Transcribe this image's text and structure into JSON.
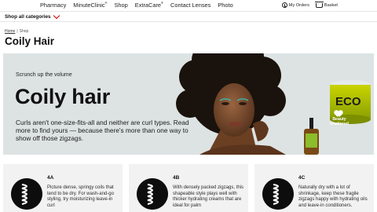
{
  "nav": {
    "links": [
      {
        "label": "Pharmacy",
        "sup": ""
      },
      {
        "label": "MinuteClinic",
        "sup": "®"
      },
      {
        "label": "Shop",
        "sup": ""
      },
      {
        "label": "ExtraCare",
        "sup": "®"
      },
      {
        "label": "Contact Lenses",
        "sup": ""
      },
      {
        "label": "Photo",
        "sup": ""
      }
    ],
    "my_orders": "My Orders",
    "basket": "Basket"
  },
  "category_bar": {
    "shop_all": "Shop all categories"
  },
  "breadcrumb": {
    "home": "Home",
    "separator": "|",
    "current": "Shop"
  },
  "page_title": "Coily Hair",
  "hero": {
    "kicker": "Scrunch up the volume",
    "headline": "Coily hair",
    "body": "Curls aren't one-size-fits-all and neither are curl types. Read more to find yours — because there's more than one way to show off those zigzags.",
    "badge_line1": "Beauty",
    "badge_line2": "Unaltered",
    "background_color": "#dde3e3"
  },
  "cards": [
    {
      "type": "4A",
      "description": "Picture dense, springy coils that tend to be dry. For wash-and-go styling, try moisturizing leave-in curl"
    },
    {
      "type": "4B",
      "description": "With densely packed zigzags, this shapeable style plays well with thicker hydrating creams that are ideal for palm"
    },
    {
      "type": "4C",
      "description": "Naturally dry with a lot of shrinkage, keep these fragile zigzags happy with hydrating oils and leave-in conditioners."
    }
  ],
  "colors": {
    "accent_red": "#cc0000",
    "card_bg": "#f2f2f2",
    "coil_icon_bg": "#0d0d0d"
  },
  "icons": [
    "orders-icon",
    "basket-icon",
    "chevron-down-icon",
    "beauty-unaltered-logo",
    "coil-hair-icon"
  ]
}
